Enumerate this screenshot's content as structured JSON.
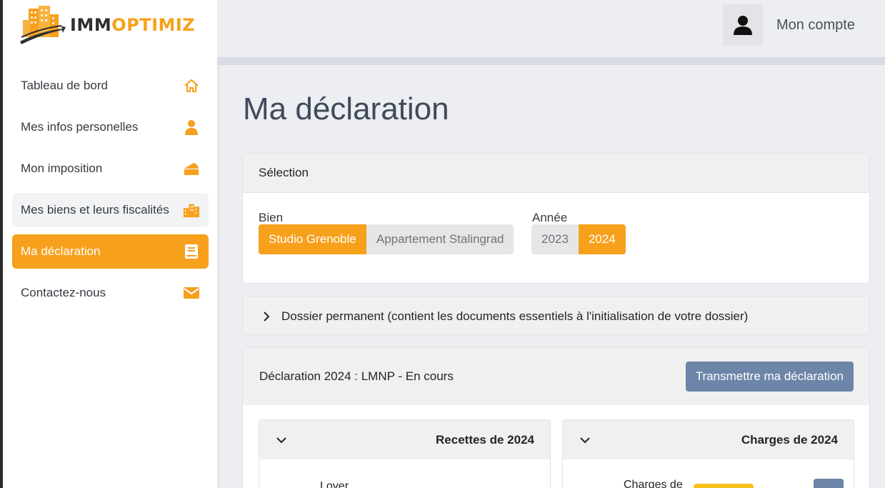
{
  "brand": {
    "logo_dark": "IMM",
    "logo_accent": "OPTIMIZ",
    "accent_color": "#f7a01c"
  },
  "sidebar": {
    "items": [
      {
        "label": "Tableau de bord",
        "icon": "home-icon",
        "state": "normal"
      },
      {
        "label": "Mes infos personelles",
        "icon": "user-icon",
        "state": "normal"
      },
      {
        "label": "Mon imposition",
        "icon": "cheese-icon",
        "state": "normal"
      },
      {
        "label": "Mes biens et leurs fiscalités",
        "icon": "city-icon",
        "state": "hover"
      },
      {
        "label": "Ma déclaration",
        "icon": "book-icon",
        "state": "active"
      },
      {
        "label": "Contactez-nous",
        "icon": "envelope-icon",
        "state": "normal"
      }
    ]
  },
  "header": {
    "account_label": "Mon compte",
    "account_icon": "user-avatar-icon"
  },
  "main": {
    "title": "Ma déclaration",
    "selection": {
      "header": "Sélection",
      "bien_label": "Bien",
      "biens": [
        "Studio Grenoble",
        "Appartement Stalingrad"
      ],
      "bien_selected": "Studio Grenoble",
      "annee_label": "Année",
      "annees": [
        "2023",
        "2024"
      ],
      "annee_selected": "2024"
    },
    "dossier": {
      "label": "Dossier permanent (contient les documents essentiels à l'initialisation de votre dossier)"
    },
    "declaration": {
      "status": "Déclaration 2024 : LMNP - En cours",
      "submit_label": "Transmettre ma déclaration",
      "recettes": {
        "title": "Recettes de 2024",
        "first_item": "Loyer"
      },
      "charges": {
        "title": "Charges de 2024",
        "first_item": "Charges de"
      }
    }
  }
}
